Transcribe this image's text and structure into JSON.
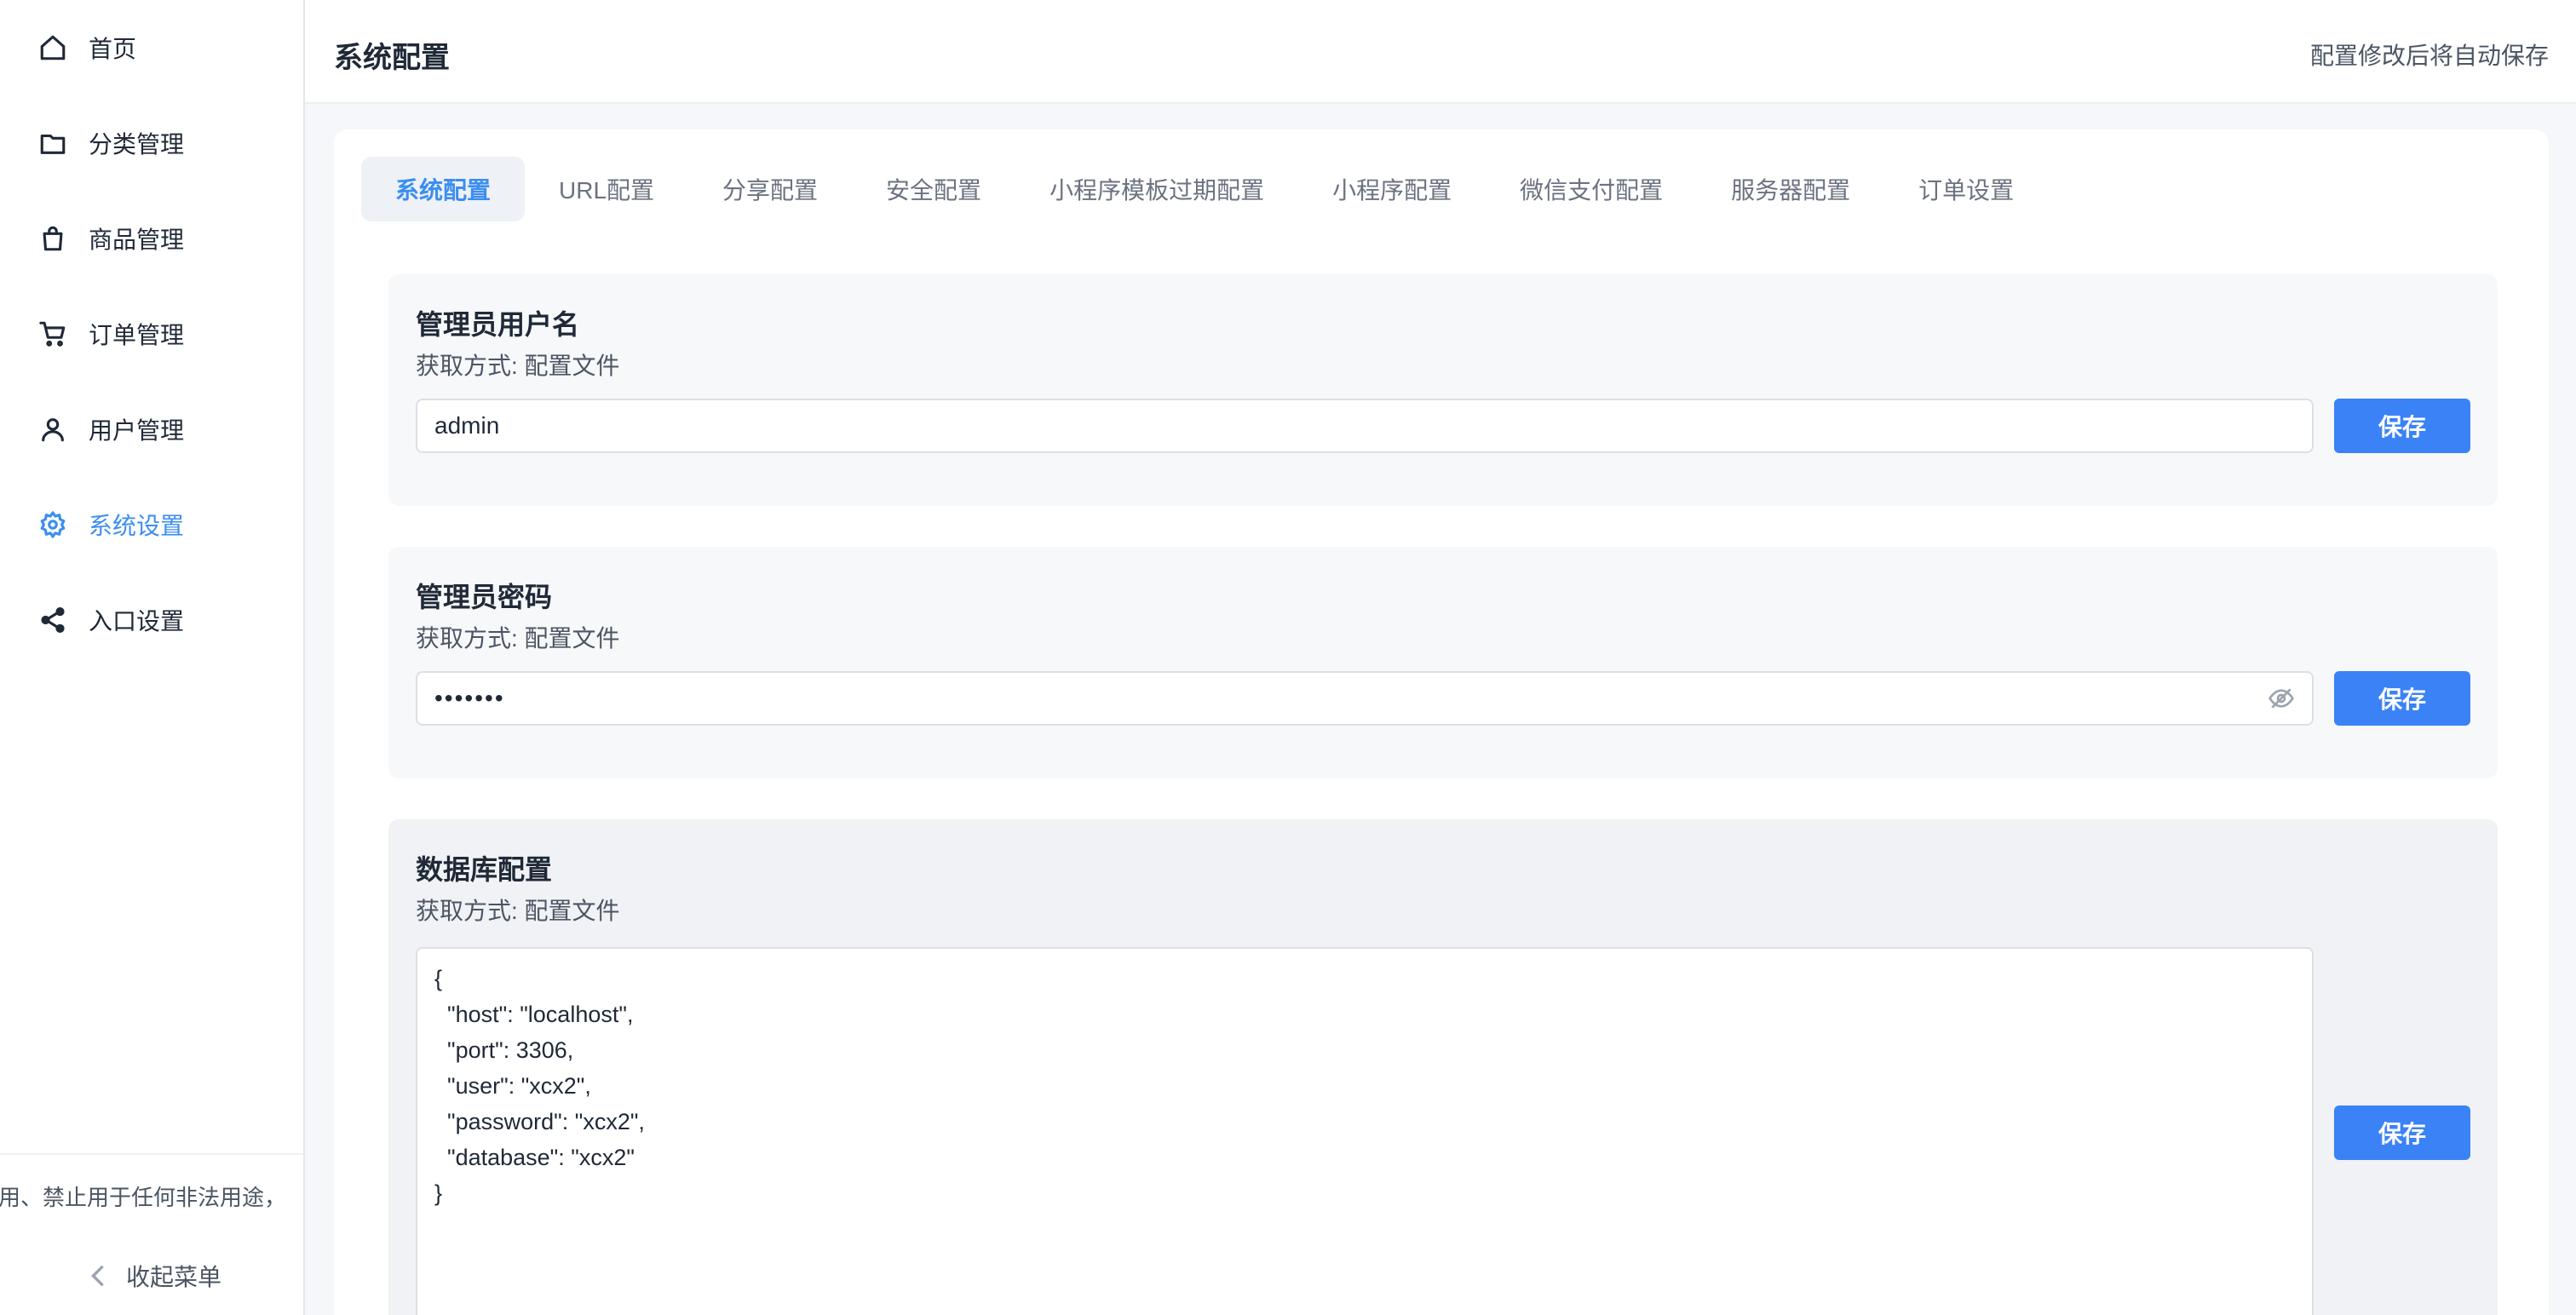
{
  "sidebar": {
    "items": [
      {
        "label": "首页",
        "icon": "home-icon"
      },
      {
        "label": "分类管理",
        "icon": "folder-icon"
      },
      {
        "label": "商品管理",
        "icon": "shopping-bag-icon"
      },
      {
        "label": "订单管理",
        "icon": "cart-icon"
      },
      {
        "label": "用户管理",
        "icon": "user-icon"
      },
      {
        "label": "系统设置",
        "icon": "gear-icon",
        "active": true
      },
      {
        "label": "入口设置",
        "icon": "share-icon"
      }
    ],
    "notice": "用、禁止用于任何非法用途，",
    "collapse_label": "收起菜单"
  },
  "header": {
    "title": "系统配置",
    "autosave_text": "配置修改后将自动保存"
  },
  "tabs": [
    {
      "label": "系统配置",
      "active": true
    },
    {
      "label": "URL配置"
    },
    {
      "label": "分享配置"
    },
    {
      "label": "安全配置"
    },
    {
      "label": "小程序模板过期配置"
    },
    {
      "label": "小程序配置"
    },
    {
      "label": "微信支付配置"
    },
    {
      "label": "服务器配置"
    },
    {
      "label": "订单设置"
    }
  ],
  "sections": {
    "admin_username": {
      "title": "管理员用户名",
      "source": "获取方式: 配置文件",
      "value": "admin",
      "save_label": "保存"
    },
    "admin_password": {
      "title": "管理员密码",
      "source": "获取方式: 配置文件",
      "masked_value": "•••••••",
      "save_label": "保存"
    },
    "database": {
      "title": "数据库配置",
      "source": "获取方式: 配置文件",
      "value": "{\n  \"host\": \"localhost\",\n  \"port\": 3306,\n  \"user\": \"xcx2\",\n  \"password\": \"xcx2\",\n  \"database\": \"xcx2\"\n}",
      "save_label": "保存"
    }
  },
  "colors": {
    "accent": "#3b8ef0",
    "button": "#3b82f6"
  }
}
